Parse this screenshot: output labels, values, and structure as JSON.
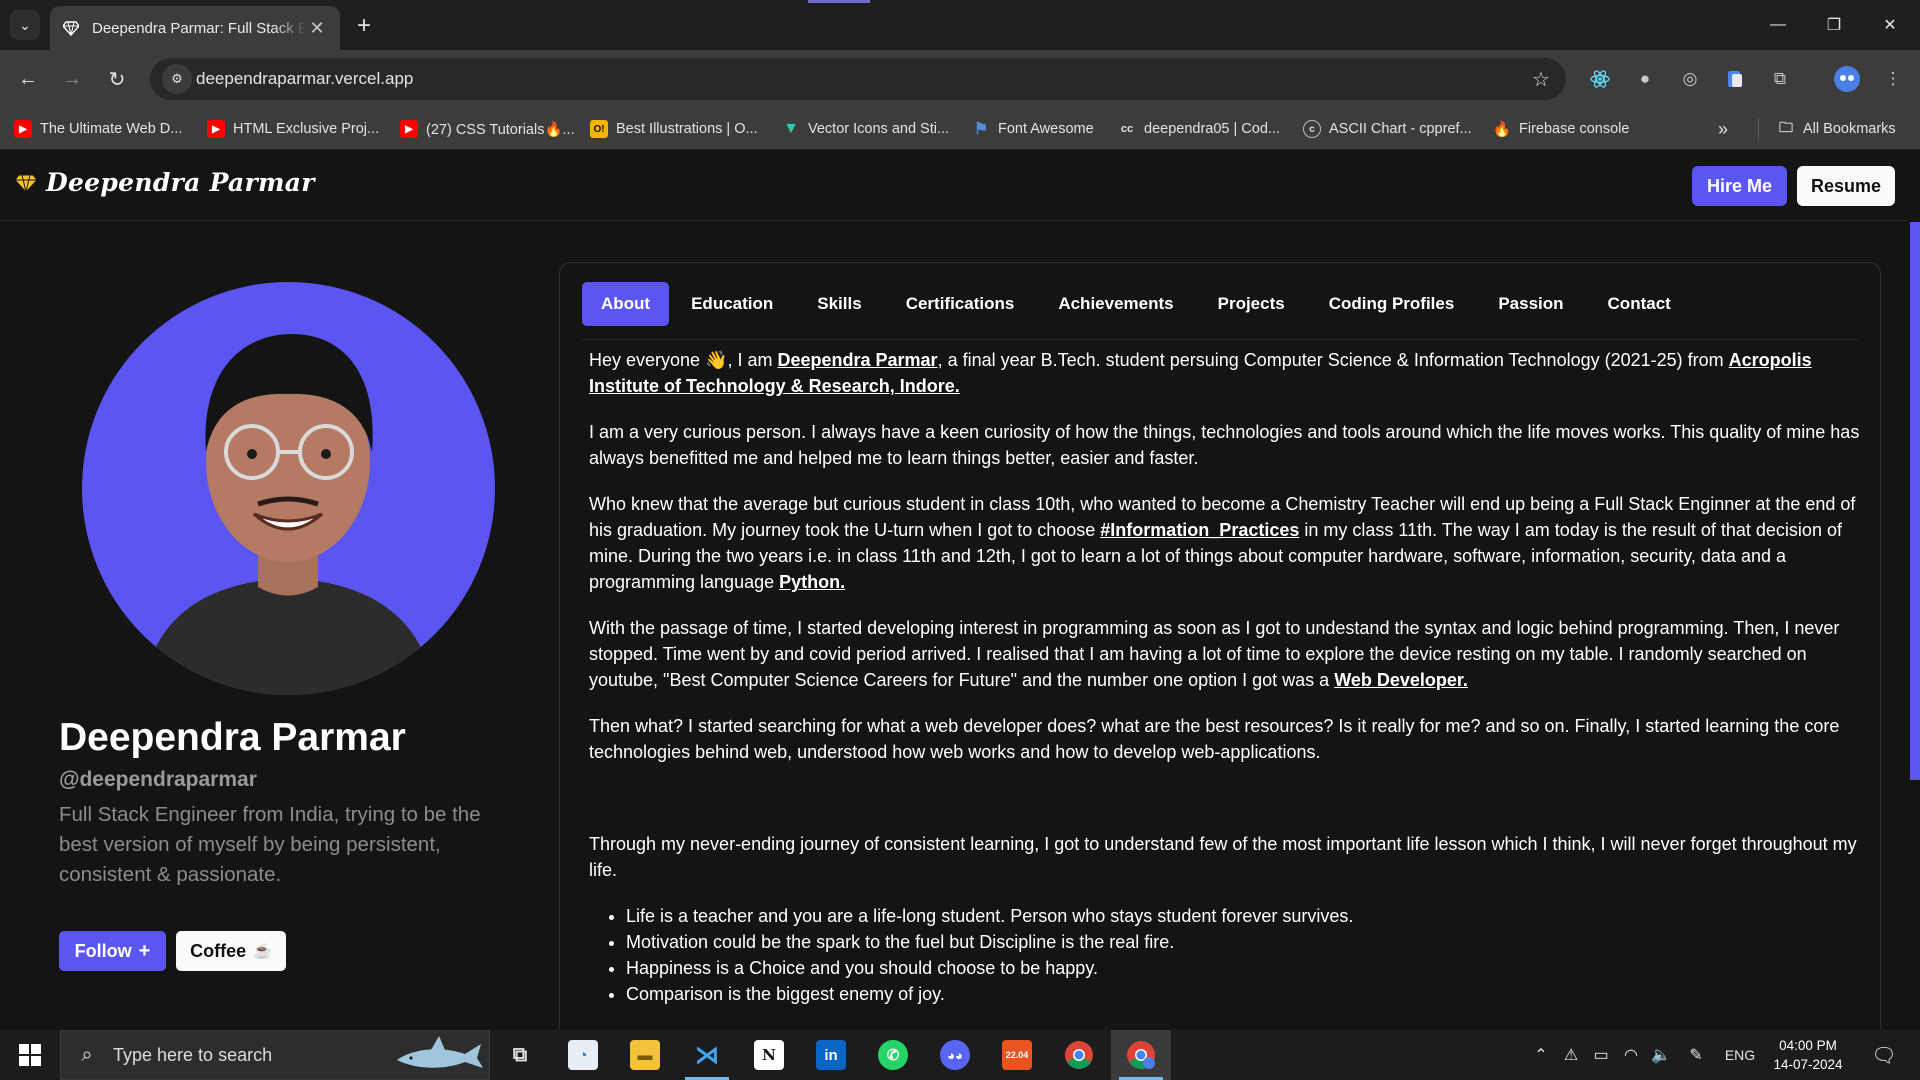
{
  "browser": {
    "tab_title": "Deependra Parmar: Full Stack Engineer",
    "url": "deependraparmar.vercel.app",
    "bookmarks": [
      {
        "label": "The Ultimate Web D...",
        "icon": "youtube-icon",
        "color": "#ff0000"
      },
      {
        "label": "HTML Exclusive Proj...",
        "icon": "youtube-icon",
        "color": "#ff0000"
      },
      {
        "label": "(27) CSS Tutorials🔥...",
        "icon": "youtube-icon",
        "color": "#ff0000"
      },
      {
        "label": "Best Illustrations | O...",
        "icon": "ouch-icon",
        "color": "#f5b400"
      },
      {
        "label": "Vector Icons and Sti...",
        "icon": "flaticon-icon",
        "color": "#2ec4b6"
      },
      {
        "label": "Font Awesome",
        "icon": "fontawesome-flag-icon",
        "color": "#528dd7"
      },
      {
        "label": "deependra05 | Cod...",
        "icon": "codechef-icon",
        "color": "#3a3a3a"
      },
      {
        "label": "ASCII Chart - cppref...",
        "icon": "cppreference-icon",
        "color": "#555555"
      },
      {
        "label": "Firebase console",
        "icon": "firebase-icon",
        "color": "#ffa000"
      }
    ],
    "all_bookmarks": "All Bookmarks"
  },
  "site": {
    "brand": "Deependra Parmar",
    "hire_label": "Hire Me",
    "resume_label": "Resume",
    "accent": "#5b55f2"
  },
  "profile": {
    "name": "Deependra Parmar",
    "handle": "@deependraparmar",
    "bio": "Full Stack Engineer from India, trying to be the best version of myself by being persistent, consistent & passionate.",
    "follow_label": "Follow",
    "coffee_label": "Coffee"
  },
  "tabs": [
    "About",
    "Education",
    "Skills",
    "Certifications",
    "Achievements",
    "Projects",
    "Coding Profiles",
    "Passion",
    "Contact"
  ],
  "about": {
    "p1_a": "Hey everyone 👋, I am ",
    "p1_link1": "Deependra Parmar",
    "p1_b": ", a final year B.Tech. student persuing Computer Science & Information Technology (2021-25) from ",
    "p1_link2": "Acropolis Institute of Technology & Research, Indore.",
    "p2": "I am a very curious person. I always have a keen curiosity of how the things, technologies and tools around which the life moves works. This quality of mine has always benefitted me and helped me to learn things better, easier and faster.",
    "p3_a": "Who knew that the average but curious student in class 10th, who wanted to become a Chemistry Teacher will end up being a Full Stack Enginner at the end of his graduation. My journey took the U-turn when I got to choose ",
    "p3_link1": "#Information_Practices",
    "p3_b": " in my class 11th. The way I am today is the result of that decision of mine. During the two years i.e. in class 11th and 12th, I got to learn a lot of things about computer hardware, software, information, security, data and a programming language ",
    "p3_link2": "Python.",
    "p4_a": "With the passage of time, I started developing interest in programming as soon as I got to undestand the syntax and logic behind programming. Then, I never stopped. Time went by and covid period arrived. I realised that I am having a lot of time to explore the device resting on my table. I randomly searched on youtube, \"Best Computer Science Careers for Future\" and the number one option I got was a ",
    "p4_link": "Web Developer.",
    "p5": "Then what? I started searching for what a web developer does? what are the best resources? Is it really for me? and so on. Finally, I started learning the core technologies behind web, understood how web works and how to develop web-applications.",
    "p6": "Through my never-ending journey of consistent learning, I got to understand few of the most important life lesson which I think, I will never forget throughout my life.",
    "lessons": [
      "Life is a teacher and you are a life-long student. Person who stays student forever survives.",
      "Motivation could be the spark to the fuel but Discipline is the real fire.",
      "Happiness is a Choice and you should choose to be happy.",
      "Comparison is the biggest enemy of joy."
    ]
  },
  "taskbar": {
    "search_placeholder": "Type here to search",
    "language": "ENG",
    "time": "04:00 PM",
    "date": "14-07-2024",
    "apps": [
      "task-view-icon",
      "lens-app-icon",
      "file-explorer-icon",
      "vscode-icon",
      "notion-icon",
      "linkedin-icon",
      "whatsapp-icon",
      "discord-icon",
      "ubuntu-22-04-icon",
      "chrome-icon",
      "chrome-active-icon"
    ]
  }
}
